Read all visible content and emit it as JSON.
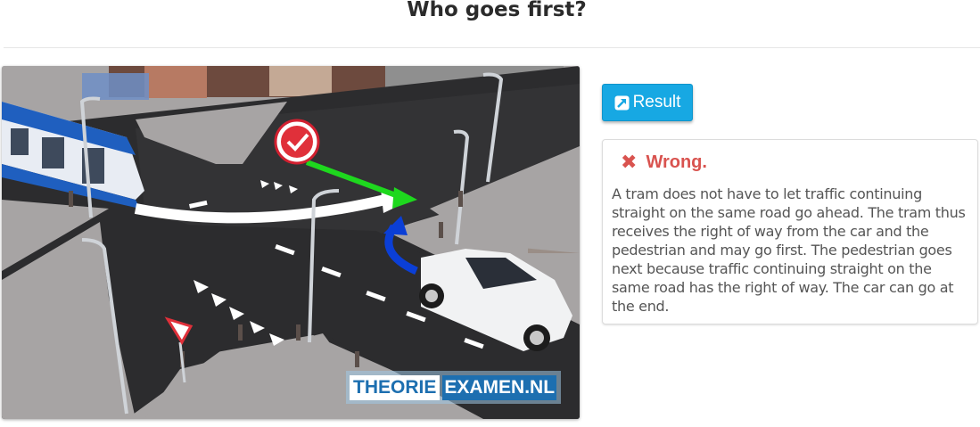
{
  "page": {
    "title": "Who goes first?"
  },
  "scene": {
    "watermark": {
      "part1": "THEORIE",
      "part2": "EXAMEN.NL"
    },
    "colors": {
      "road": "#2a2a2c",
      "sidewalk": "#a9a6a6",
      "tram_blue": "#1f5fbf",
      "arrow_green": "#1ed81e",
      "arrow_blue": "#0b3fd6",
      "check_red": "#e0303a"
    },
    "icons": [
      "check-icon",
      "yield-sign-icon",
      "tram",
      "car"
    ]
  },
  "result_button": {
    "label": "Result",
    "icon": "external-link-icon"
  },
  "feedback": {
    "status": "Wrong.",
    "status_icon": "close-icon",
    "status_color": "#d9534f",
    "explanation": "A tram does not have to let traffic continuing straight on the same road go ahead. The tram thus receives the right of way from the car and the pedestrian and may go first. The pedestrian goes next because traffic continuing straight on the same road has the right of way. The car can go at the end."
  }
}
